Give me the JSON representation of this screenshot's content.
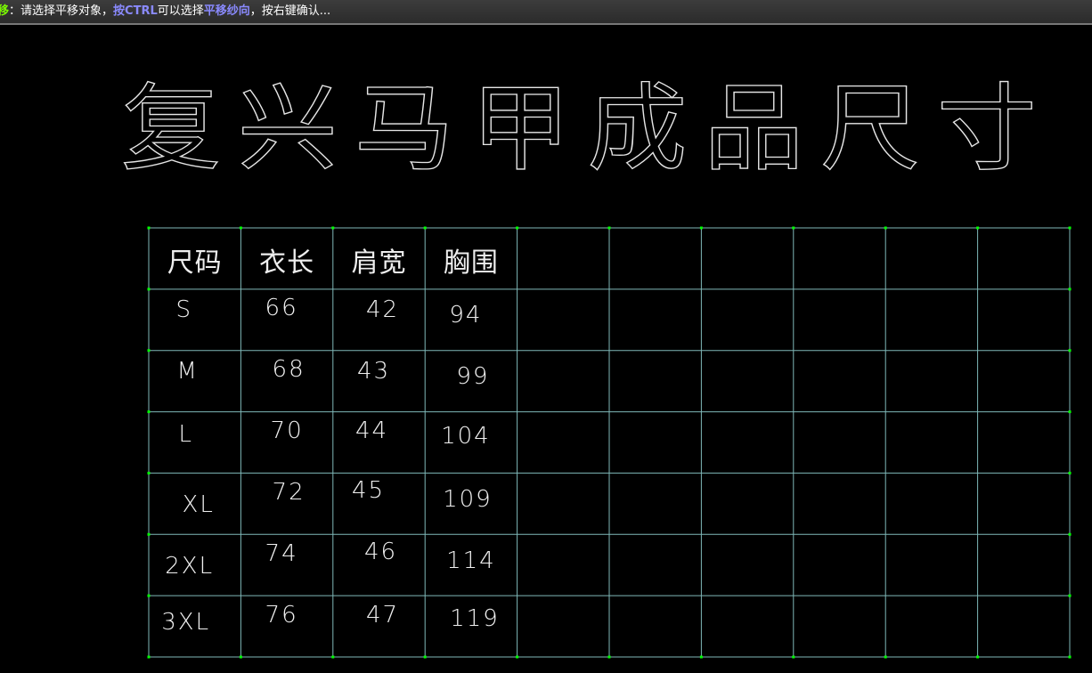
{
  "prompt": {
    "command": "移",
    "segments": [
      {
        "text": "：请选择平移对象，",
        "style": "txt"
      },
      {
        "text": "按CTRL",
        "style": "hl"
      },
      {
        "text": "可以选择",
        "style": "txt"
      },
      {
        "text": "平移纱向",
        "style": "hl"
      },
      {
        "text": "，按右键确认...",
        "style": "txt"
      }
    ]
  },
  "drawing": {
    "title_chars": [
      "复",
      "兴",
      "马",
      "甲",
      "成",
      "品",
      "尺",
      "寸"
    ]
  },
  "table": {
    "headers": [
      "尺码",
      "衣长",
      "肩宽",
      "胸围"
    ],
    "rows": [
      [
        "S",
        "66",
        "42",
        "94"
      ],
      [
        "M",
        "68",
        "43",
        "99"
      ],
      [
        "L",
        "70",
        "44",
        "104"
      ],
      [
        "XL",
        "72",
        "45",
        "109"
      ],
      [
        "2XL",
        "74",
        "46",
        "114"
      ],
      [
        "3XL",
        "76",
        "47",
        "119"
      ]
    ],
    "total_columns": 10
  },
  "colors": {
    "grid_line": "#7fb8b8",
    "vertex": "#00ff00",
    "text": "#f0f0f0",
    "background": "#000000",
    "command": "#7CFC00",
    "highlight": "#8a8aff"
  }
}
